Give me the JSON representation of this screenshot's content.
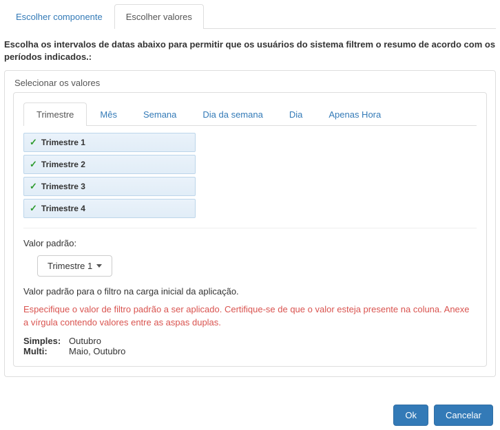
{
  "outerTabs": {
    "choose_component": "Escolher componente",
    "choose_values": "Escolher valores"
  },
  "instruction": "Escolha os intervalos de datas abaixo para permitir que os usuários do sistema filtrem o resumo de acordo com os períodos indicados.:",
  "fieldset_legend": "Selecionar os valores",
  "innerTabs": {
    "trimestre": "Trimestre",
    "mes": "Mês",
    "semana": "Semana",
    "dia_semana": "Dia da semana",
    "dia": "Dia",
    "apenas_hora": "Apenas Hora"
  },
  "values": {
    "trimestre1": "Trimestre 1",
    "trimestre2": "Trimestre 2",
    "trimestre3": "Trimestre 3",
    "trimestre4": "Trimestre 4"
  },
  "default_section": {
    "label": "Valor padrão:",
    "selected": "Trimestre 1",
    "help": "Valor padrão para o filtro na carga inicial da aplicação.",
    "warning": "Especifique o valor de filtro padrão a ser aplicado. Certifique-se de que o valor esteja presente na coluna. Anexe a vírgula contendo valores entre as aspas duplas.",
    "example_simple_label": "Simples:",
    "example_simple_value": "Outubro",
    "example_multi_label": "Multi:",
    "example_multi_value": "Maio, Outubro"
  },
  "footer": {
    "ok": "Ok",
    "cancel": "Cancelar"
  }
}
